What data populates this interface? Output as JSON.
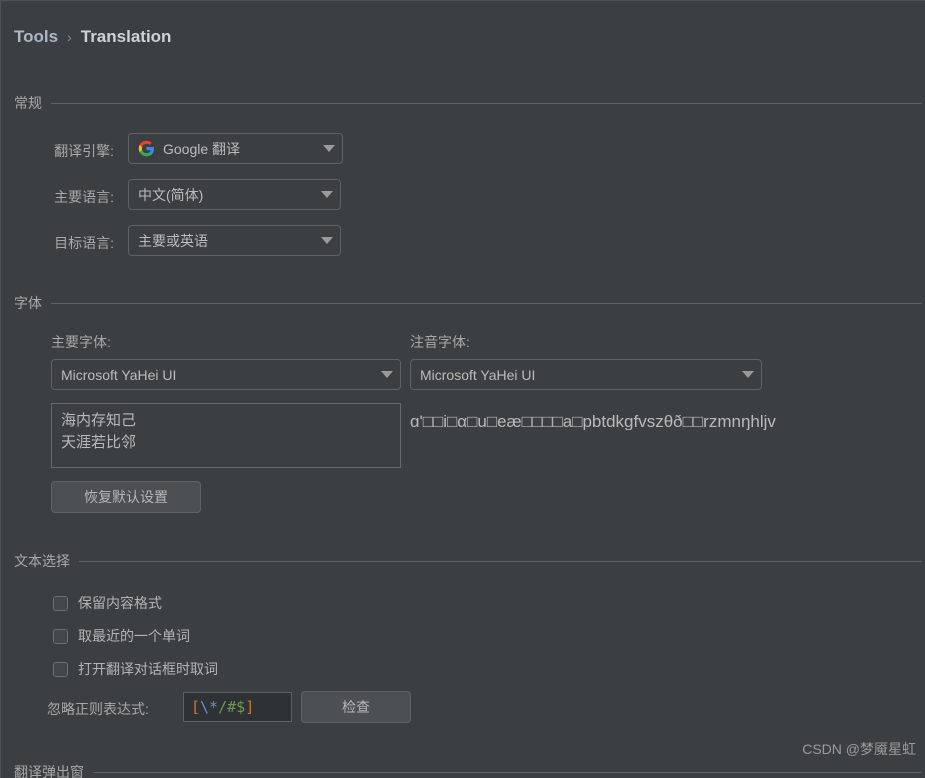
{
  "breadcrumb": {
    "root": "Tools",
    "separator": "›",
    "leaf": "Translation"
  },
  "sections": {
    "general": "常规",
    "font": "字体",
    "text_selection": "文本选择",
    "translation_popup": "翻译弹出窗"
  },
  "general": {
    "engine": {
      "label": "翻译引擎:",
      "value": "Google 翻译",
      "icon": "google-logo-icon"
    },
    "primary_language": {
      "label": "主要语言:",
      "value": "中文(简体)"
    },
    "target_language": {
      "label": "目标语言:",
      "value": "主要或英语"
    }
  },
  "font": {
    "primary": {
      "label": "主要字体:",
      "value": "Microsoft YaHei UI",
      "preview": "海内存知己\n天涯若比邻"
    },
    "phonetic": {
      "label": "注音字体:",
      "value": "Microsoft YaHei UI",
      "preview": "ɑ'□□i□α□u□eæ□□□□a□pbtdkgfvszθð□□rzmnŋhljv"
    },
    "restore_button": "恢复默认设置"
  },
  "text_selection": {
    "checkboxes": [
      {
        "label": "保留内容格式",
        "checked": false
      },
      {
        "label": "取最近的一个单词",
        "checked": false
      },
      {
        "label": "打开翻译对话框时取词",
        "checked": false
      }
    ],
    "ignore_regex": {
      "label": "忽略正则表达式:",
      "tokens": [
        {
          "text": "[",
          "color": "#cc7832"
        },
        {
          "text": "\\*",
          "color": "#6a8fd0"
        },
        {
          "text": "/#$",
          "color": "#6a9955"
        },
        {
          "text": "]",
          "color": "#cc7832"
        }
      ],
      "value": "[\\*/#$]"
    },
    "check_button": "检查"
  },
  "watermark": "CSDN @梦魇星虹"
}
